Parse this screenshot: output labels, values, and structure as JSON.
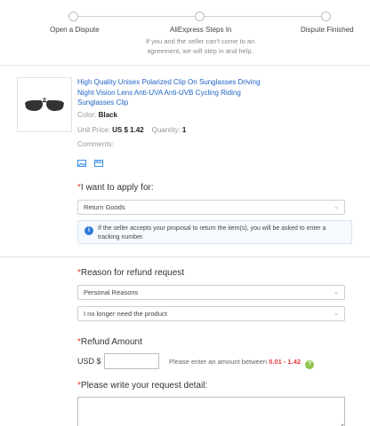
{
  "steps": [
    {
      "label": "Open a Dispute"
    },
    {
      "label": "AliExpress Steps In",
      "sub": "If you and the seller can't come to an agreement, we will step in and help."
    },
    {
      "label": "Dispute Finished"
    }
  ],
  "product": {
    "title": "High Quality Unisex Polarized Clip On Sunglasses Driving Night Vision Lens Anti-UVA Anti-UVB Cycling Riding Sunglasses Clip",
    "color_label": "Color:",
    "color_value": "Black",
    "unit_price_label": "Unit Price:",
    "unit_price_value": "US $ 1.42",
    "quantity_label": "Quantity:",
    "quantity_value": "1",
    "comments_label": "Comments:"
  },
  "apply": {
    "label": "I want to apply for:",
    "selected": "Return Goods",
    "info": "If the seller accepts your proposal to return the item(s), you will be asked to enter a tracking number."
  },
  "reason": {
    "label": "Reason for refund request",
    "selected_1": "Personal Reasons",
    "selected_2": "I no longer need the product"
  },
  "refund": {
    "label": "Refund Amount",
    "currency": "USD $",
    "hint": "Please enter an amount between",
    "range": "0.01 - 1.42",
    "value": ""
  },
  "detail": {
    "label": "Please write your request detail:"
  },
  "colors": {
    "link": "#1f64c4",
    "required": "#e53935",
    "info_icon": "#2f7bd6",
    "help_icon": "#8bc34a"
  }
}
